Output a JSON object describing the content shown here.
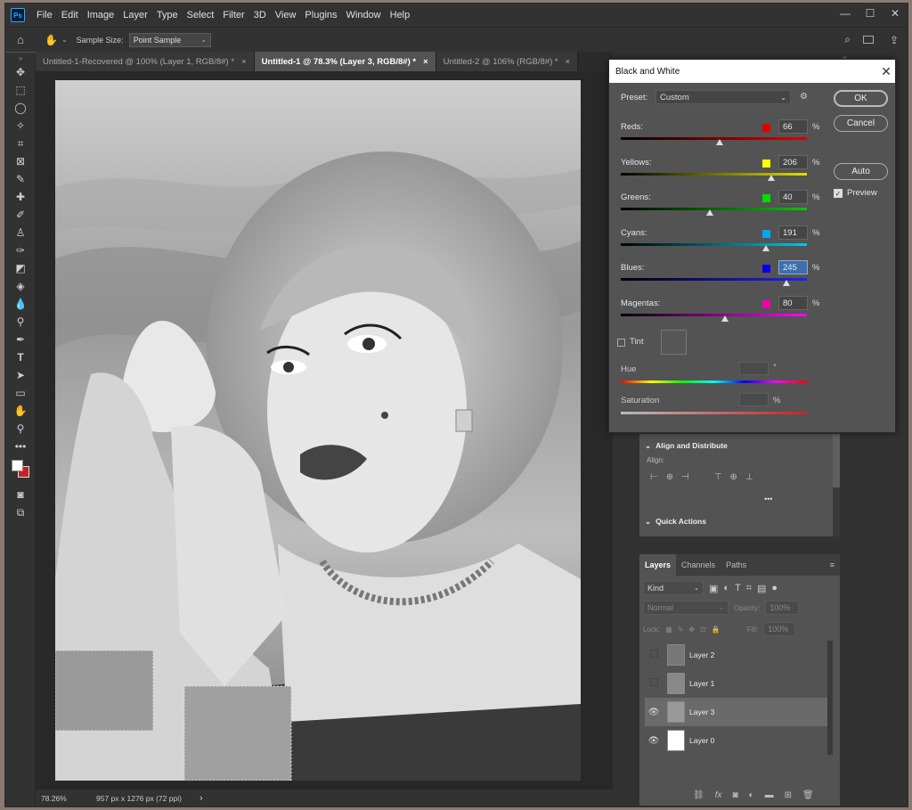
{
  "app": {
    "logo": "Ps"
  },
  "menu": [
    "File",
    "Edit",
    "Image",
    "Layer",
    "Type",
    "Select",
    "Filter",
    "3D",
    "View",
    "Plugins",
    "Window",
    "Help"
  ],
  "window_controls": {
    "minimize": "—",
    "maximize": "☐",
    "close": "✕"
  },
  "options_bar": {
    "sample_size_label": "Sample Size:",
    "sample_size_value": "Point Sample"
  },
  "tabs": [
    {
      "label": "Untitled-1-Recovered @ 100% (Layer 1, RGB/8#) *",
      "close": "×"
    },
    {
      "label": "Untitled-1 @ 78.3% (Layer 3, RGB/8#) *",
      "close": "×"
    },
    {
      "label": "Untitled-2 @ 106% (RGB/8#) *",
      "close": "×"
    }
  ],
  "status": {
    "zoom": "78.26%",
    "doc_info": "957 px x 1276 px (72 ppi)",
    "arrow": "›"
  },
  "dialog": {
    "title": "Black and White",
    "close": "✕",
    "preset_label": "Preset:",
    "preset_value": "Custom",
    "percent": "%",
    "channels": [
      {
        "name": "Reds:",
        "value": "66",
        "swatch": "#e00000",
        "fraction": 0.53,
        "gradient": "linear-gradient(90deg,#000,#e00000)"
      },
      {
        "name": "Yellows:",
        "value": "206",
        "swatch": "#ffff00",
        "fraction": 0.81,
        "gradient": "linear-gradient(90deg,#000,#e0e000)"
      },
      {
        "name": "Greens:",
        "value": "40",
        "swatch": "#00dd00",
        "fraction": 0.48,
        "gradient": "linear-gradient(90deg,#000,#00c800)"
      },
      {
        "name": "Cyans:",
        "value": "191",
        "swatch": "#00a8f0",
        "fraction": 0.78,
        "gradient": "linear-gradient(90deg,#000,#00c8e0)"
      },
      {
        "name": "Blues:",
        "value": "245",
        "swatch": "#0000ee",
        "fraction": 0.89,
        "gradient": "linear-gradient(90deg,#000,#2020ff)"
      },
      {
        "name": "Magentas:",
        "value": "80",
        "swatch": "#ee00aa",
        "fraction": 0.56,
        "gradient": "linear-gradient(90deg,#000,#ff00ff)"
      }
    ],
    "ok": "OK",
    "cancel": "Cancel",
    "auto": "Auto",
    "preview": "Preview",
    "tint": "Tint",
    "hue": "Hue",
    "hue_unit": "°",
    "saturation": "Saturation",
    "sat_unit": "%"
  },
  "properties": {
    "align_title": "Align and Distribute",
    "align_label": "Align:",
    "more": "•••",
    "quick_actions": "Quick Actions"
  },
  "layers_panel": {
    "tabs": [
      "Layers",
      "Channels",
      "Paths"
    ],
    "kind": "Kind",
    "blend": "Normal",
    "opacity_label": "Opacity:",
    "opacity": "100%",
    "lock_label": "Lock:",
    "fill_label": "Fill:",
    "fill": "100%",
    "layers": [
      {
        "name": "Layer 2",
        "visible": false
      },
      {
        "name": "Layer 1",
        "visible": false
      },
      {
        "name": "Layer 3",
        "visible": true,
        "selected": true
      },
      {
        "name": "Layer 0",
        "visible": true
      }
    ]
  }
}
